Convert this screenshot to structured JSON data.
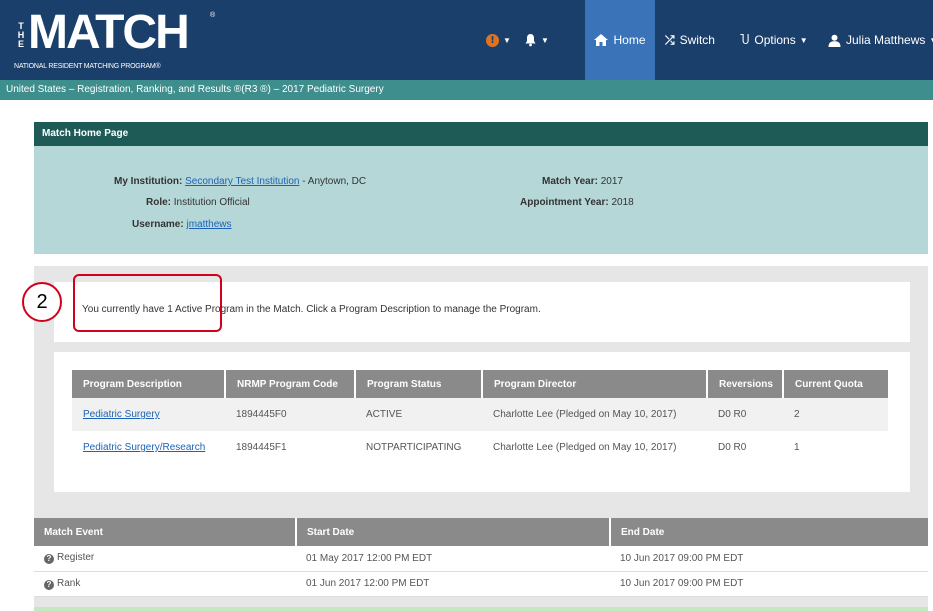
{
  "logo": {
    "the": [
      "T",
      "H",
      "E"
    ],
    "word": "MATCH",
    "reg": "®",
    "subtitle": "NATIONAL RESIDENT MATCHING PROGRAM®"
  },
  "nav": {
    "home": "Home",
    "switch": "Switch",
    "options": "Options",
    "user": "Julia Matthews"
  },
  "breadcrumb": "United States  –  Registration, Ranking, and Results ®(R3 ®)  –  2017 Pediatric Surgery",
  "home_panel": {
    "title": "Match Home Page",
    "institution_label": "My Institution:",
    "institution_link": "Secondary Test Institution",
    "institution_location": " - Anytown, DC",
    "role_label": "Role:",
    "role_value": "Institution Official",
    "username_label": "Username:",
    "username_value": "jmatthews",
    "match_year_label": "Match Year:",
    "match_year_value": "2017",
    "appt_year_label": "Appointment Year:",
    "appt_year_value": "2018"
  },
  "notice": "You currently have 1 Active Program in the Match. Click a Program Description to manage the Program.",
  "programs": {
    "headers": [
      "Program Description",
      "NRMP Program Code",
      "Program Status",
      "Program Director",
      "Reversions",
      "Current Quota"
    ],
    "rows": [
      [
        "Pediatric Surgery",
        "1894445F0",
        "ACTIVE",
        "Charlotte Lee (Pledged on May 10, 2017)",
        "D0 R0",
        "2"
      ],
      [
        "Pediatric Surgery/Research",
        "1894445F1",
        "NOTPARTICIPATING",
        "Charlotte Lee (Pledged on May 10, 2017)",
        "D0 R0",
        "1"
      ]
    ]
  },
  "callout_number": "2",
  "events": {
    "headers": [
      "Match Event",
      "Start Date",
      "End Date"
    ],
    "rows": [
      [
        "Register",
        "01 May 2017 12:00 PM EDT",
        "10 Jun 2017 09:00 PM EDT"
      ],
      [
        "Rank",
        "01 Jun 2017 12:00 PM EDT",
        "10 Jun 2017 09:00 PM EDT"
      ]
    ]
  },
  "colors": {
    "navbar": "#1b3f6b",
    "home_active": "#3a73b8",
    "breadcrumb": "#3e8e8e",
    "panel_header": "#1e5b57",
    "panel_body": "#b5d7d7",
    "table_header": "#8a8a8a",
    "callout": "#d0021b"
  }
}
